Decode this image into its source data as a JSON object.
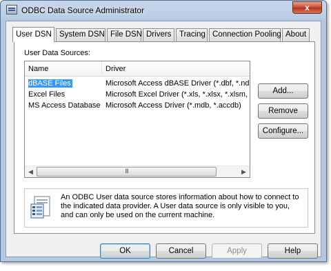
{
  "window": {
    "title": "ODBC Data Source Administrator",
    "close_glyph": "x"
  },
  "tabs": [
    {
      "label": "User DSN",
      "active": true
    },
    {
      "label": "System DSN"
    },
    {
      "label": "File DSN"
    },
    {
      "label": "Drivers"
    },
    {
      "label": "Tracing"
    },
    {
      "label": "Connection Pooling"
    },
    {
      "label": "About"
    }
  ],
  "user_dsn": {
    "group_label": "User Data Sources:",
    "columns": [
      "Name",
      "Driver"
    ],
    "rows": [
      {
        "name": "dBASE Files",
        "driver": "Microsoft Access dBASE Driver (*.dbf, *.ndx",
        "selected": true
      },
      {
        "name": "Excel Files",
        "driver": "Microsoft Excel Driver (*.xls, *.xlsx, *.xlsm, *.x"
      },
      {
        "name": "MS Access Database",
        "driver": "Microsoft Access Driver (*.mdb, *.accdb)"
      }
    ],
    "scroll_grip": "III",
    "add_label": "Add...",
    "remove_label": "Remove",
    "configure_label": "Configure...",
    "info_lines": [
      "An ODBC User data source stores information about how to connect to",
      "the indicated data provider.  A User data source is only visible to you,",
      "and can only be used on the current machine."
    ]
  },
  "footer": {
    "ok": "OK",
    "cancel": "Cancel",
    "apply": "Apply",
    "help": "Help"
  },
  "icons": {
    "app": "odbc-admin-icon",
    "info": "data-source-document-icon",
    "scroll_left": "chevron-left-icon",
    "scroll_right": "chevron-right-icon"
  },
  "colors": {
    "selection": "#3399ff",
    "title_bar": "#b9cde6",
    "close_button": "#c7452c"
  }
}
